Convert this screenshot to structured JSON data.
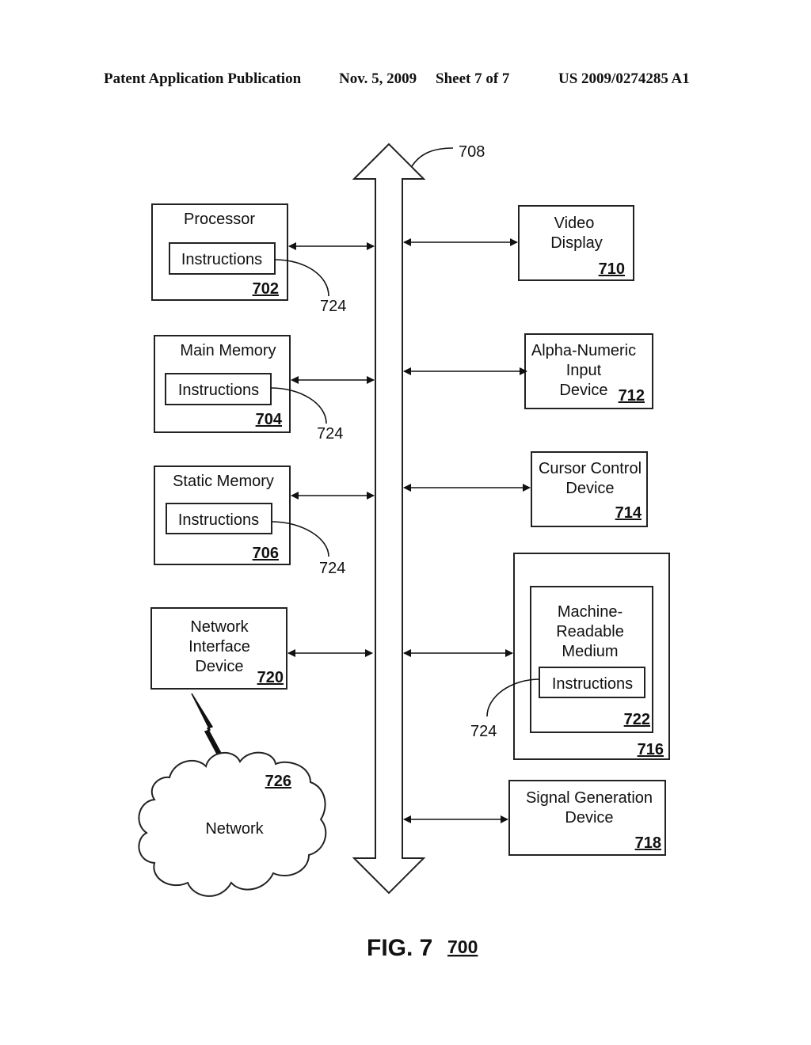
{
  "header": {
    "publication": "Patent Application Publication",
    "date": "Nov. 5, 2009",
    "sheet": "Sheet 7 of 7",
    "number": "US 2009/0274285 A1"
  },
  "bus": {
    "ref": "708"
  },
  "instructions_ref": "724",
  "instructions_label": "Instructions",
  "left_components": [
    {
      "id": "processor",
      "lines": [
        "Processor"
      ],
      "ref": "702",
      "has_instructions": true
    },
    {
      "id": "main-memory",
      "lines": [
        "Main Memory"
      ],
      "ref": "704",
      "has_instructions": true
    },
    {
      "id": "static-memory",
      "lines": [
        "Static Memory"
      ],
      "ref": "706",
      "has_instructions": true
    },
    {
      "id": "network-interface-device",
      "lines": [
        "Network",
        "Interface",
        "Device"
      ],
      "ref": "720",
      "has_instructions": false
    }
  ],
  "right_components": [
    {
      "id": "video-display",
      "lines": [
        "Video",
        "Display"
      ],
      "ref": "710"
    },
    {
      "id": "alpha-numeric-input-device",
      "lines": [
        "Alpha-Numeric",
        "Input",
        "Device"
      ],
      "ref": "712"
    },
    {
      "id": "cursor-control-device",
      "lines": [
        "Cursor Control",
        "Device"
      ],
      "ref": "714"
    },
    {
      "id": "drive-unit",
      "lines": [],
      "ref": "716"
    },
    {
      "id": "signal-generation-device",
      "lines": [
        "Signal Generation",
        "Device"
      ],
      "ref": "718"
    }
  ],
  "medium": {
    "lines": [
      "Machine-",
      "Readable",
      "Medium"
    ],
    "ref": "722"
  },
  "network": {
    "label": "Network",
    "ref": "726"
  },
  "figure": {
    "label": "FIG. 7",
    "ref": "700"
  }
}
